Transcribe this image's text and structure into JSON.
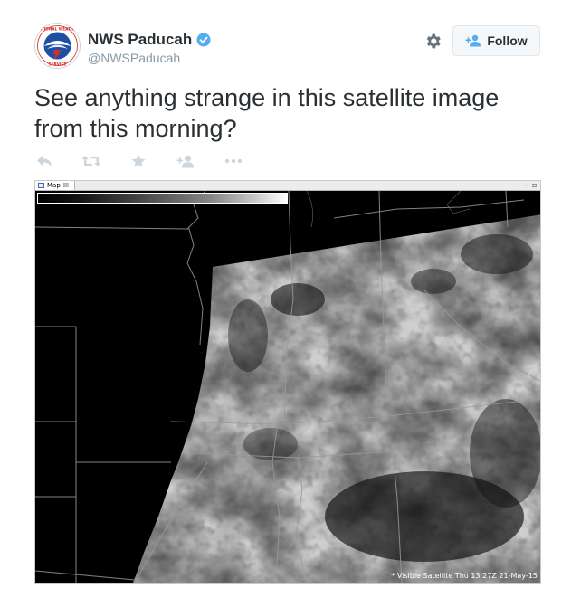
{
  "user": {
    "name": "NWS Paducah",
    "handle": "@NWSPaducah",
    "avatar_text_top": "NATIONAL WEATHER",
    "avatar_text_bottom": "SERVICE",
    "verified": true
  },
  "header": {
    "settings_icon": "gear-icon",
    "follow_label": "Follow",
    "follow_icon": "add-user-icon"
  },
  "tweet": {
    "text": "See anything strange in this satellite image from this morning?"
  },
  "actions": [
    {
      "name": "reply",
      "icon": "reply-icon"
    },
    {
      "name": "retweet",
      "icon": "retweet-icon"
    },
    {
      "name": "favorite",
      "icon": "star-icon"
    },
    {
      "name": "follow",
      "icon": "add-user-icon"
    },
    {
      "name": "more",
      "icon": "more-icon"
    }
  ],
  "media": {
    "tab_label": "Map",
    "tab_close": "☒",
    "caption": "* Visible Satellite   Thu 13:27Z 21-May-15",
    "colors": {
      "cloud": "#bdbdbd",
      "background": "#000000",
      "border_lines": "#9a9a9a"
    }
  },
  "colors": {
    "text": "#292f33",
    "muted": "#8899a6",
    "verified": "#55acee",
    "action_icons": "#ccd6dd",
    "button_bg": "#f5f8fa"
  }
}
